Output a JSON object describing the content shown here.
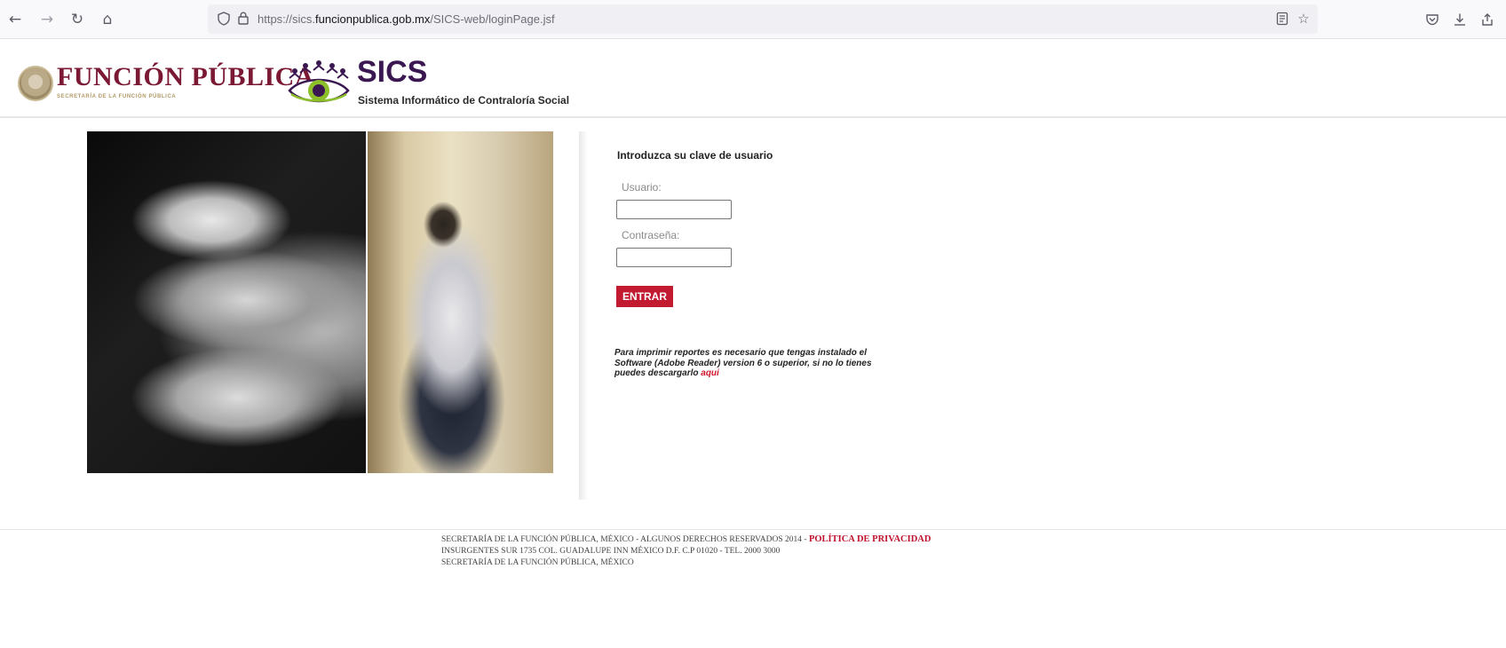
{
  "browser": {
    "url_prefix": "https://sics.",
    "url_domain": "funcionpublica.gob.mx",
    "url_path": "/SICS-web/loginPage.jsf",
    "icons": {
      "back": "back-arrow-icon",
      "forward": "forward-arrow-icon",
      "reload": "reload-icon",
      "home": "home-icon",
      "tracking": "shield-icon",
      "lock": "lock-icon",
      "reader": "reader-view-icon",
      "bookmark": "star-icon",
      "pocket": "pocket-icon",
      "downloads": "download-icon",
      "share": "share-icon"
    }
  },
  "header": {
    "brand_title": "FUNCIÓN PÚBLICA",
    "brand_subtitle": "SECRETARÍA DE LA FUNCIÓN PÚBLICA",
    "app_title": "SICS",
    "app_subtitle": "Sistema Informático de Contraloría Social"
  },
  "login": {
    "title": "Introduzca su clave de usuario",
    "user_label": "Usuario:",
    "user_value": "",
    "password_label": "Contraseña:",
    "password_value": "",
    "submit_label": "ENTRAR",
    "notice_text": "Para imprimir reportes es necesario que tengas instalado el Software (Adobe Reader) version 6 o superior, si no lo tienes puedes descargarlo ",
    "notice_link": "aqui"
  },
  "footer": {
    "line1": "SECRETARÍA DE LA FUNCIÓN PÚBLICA, MÉXICO - ALGUNOS DERECHOS RESERVADOS 2014 - ",
    "privacy_link": "POLÍTICA DE PRIVACIDAD",
    "line2": "INSURGENTES SUR 1735 COL. GUADALUPE INN MÉXICO D.F. C.P 01020 - TEL. 2000 3000",
    "line3": "SECRETARÍA DE LA FUNCIÓN PÚBLICA, MÉXICO"
  },
  "colors": {
    "brand_maroon": "#7b1834",
    "sics_purple": "#3b1752",
    "button_red": "#c21a30",
    "link_red": "#d0142a"
  }
}
